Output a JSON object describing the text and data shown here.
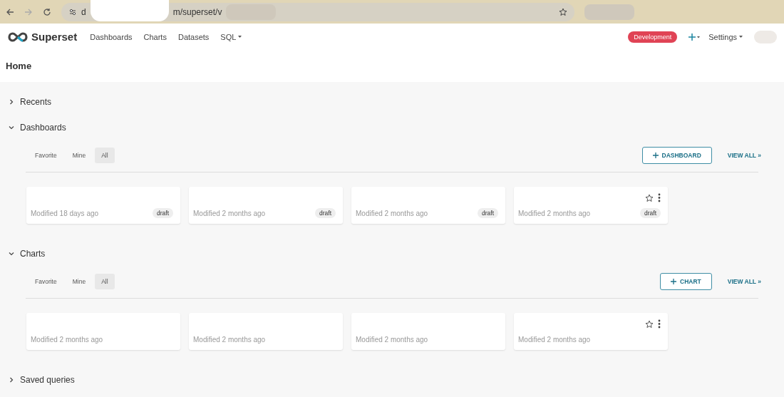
{
  "browser": {
    "url_start": "d",
    "url_end": "m/superset/v"
  },
  "navbar": {
    "brand": "Superset",
    "items": [
      {
        "label": "Dashboards",
        "dropdown": false
      },
      {
        "label": "Charts",
        "dropdown": false
      },
      {
        "label": "Datasets",
        "dropdown": false
      },
      {
        "label": "SQL",
        "dropdown": true
      }
    ],
    "environment": "Development",
    "settings": "Settings"
  },
  "page_title": "Home",
  "sections": [
    {
      "title": "Recents",
      "expanded": false
    },
    {
      "title": "Dashboards",
      "expanded": true,
      "tabs": [
        {
          "label": "Favorite",
          "selected": false
        },
        {
          "label": "Mine",
          "selected": false
        },
        {
          "label": "All",
          "selected": true
        }
      ],
      "add_button": "DASHBOARD",
      "view_all": "VIEW ALL »",
      "cards": [
        {
          "modified": "Modified 18 days ago",
          "tag": "draft",
          "actions_visible": false
        },
        {
          "modified": "Modified 2 months ago",
          "tag": "draft",
          "actions_visible": false
        },
        {
          "modified": "Modified 2 months ago",
          "tag": "draft",
          "actions_visible": false
        },
        {
          "modified": "Modified 2 months ago",
          "tag": "draft",
          "actions_visible": true
        }
      ]
    },
    {
      "title": "Charts",
      "expanded": true,
      "tabs": [
        {
          "label": "Favorite",
          "selected": false
        },
        {
          "label": "Mine",
          "selected": false
        },
        {
          "label": "All",
          "selected": true
        }
      ],
      "add_button": "CHART",
      "view_all": "VIEW ALL »",
      "cards": [
        {
          "modified": "Modified 2 months ago",
          "actions_visible": false
        },
        {
          "modified": "Modified 2 months ago",
          "actions_visible": false
        },
        {
          "modified": "Modified 2 months ago",
          "actions_visible": false
        },
        {
          "modified": "Modified 2 months ago",
          "actions_visible": true
        }
      ]
    },
    {
      "title": "Saved queries",
      "expanded": false
    }
  ]
}
